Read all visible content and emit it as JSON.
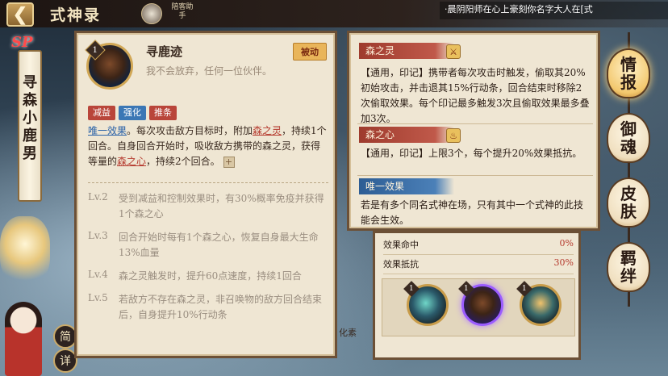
{
  "header": {
    "back_icon": "back-arrow-icon",
    "title": "式神录",
    "helper_label": "陪客助手",
    "marquee": "·晨阴阳师在心上豪刻你名字大人在[式"
  },
  "shikigami": {
    "rarity": "SP",
    "name": "寻森小鹿男"
  },
  "left_buttons": {
    "simple": "简",
    "detail": "详"
  },
  "skill": {
    "level": "1",
    "name": "寻鹿迹",
    "quote": "我不会放弃，任何一位伙伴。",
    "type": "被动",
    "tags": [
      "减益",
      "强化",
      "推条"
    ],
    "desc_parts": {
      "p1": "唯一效果",
      "p2": "。每次攻击敌方目标时，附加",
      "p3": "森之灵",
      "p4": "，持续1个回合。自身回合开始时，吸收敌方携带的森之灵，获得等量的",
      "p5": "森之心",
      "p6": "，持续2个回合。"
    },
    "levels": [
      {
        "label": "Lv.2",
        "text": "受到减益和控制效果时，有30%概率免疫并获得1个森之心"
      },
      {
        "label": "Lv.3",
        "text": "回合开始时每有1个森之心，恢复自身最大生命13%血量"
      },
      {
        "label": "Lv.4",
        "text": "森之灵触发时，提升60点速度，持续1回合"
      },
      {
        "label": "Lv.5",
        "text": "若敌方不存在森之灵，非召唤物的敌方回合结束后，自身提升10%行动条"
      }
    ]
  },
  "tooltip": {
    "sections": [
      {
        "title": "森之灵",
        "icon": "sword-icon",
        "text": "【通用，印记】携带者每次攻击时触发，偷取其20%初始攻击，并击退其15%行动条，回合结束时移除2次偷取效果。每个印记最多触发3次且偷取效果最多叠加3次。"
      },
      {
        "title": "森之心",
        "icon": "flame-icon",
        "text": "【通用，印记】上限3个，每个提升20%效果抵抗。"
      },
      {
        "title": "唯一效果",
        "icon": "",
        "text": "若是有多个同名式神在场，只有其中一个式神的此技能会生效。"
      }
    ]
  },
  "stats": [
    {
      "label": "效果命中",
      "value": "0%"
    },
    {
      "label": "效果抵抗",
      "value": "30%"
    }
  ],
  "skill_icons": [
    {
      "level": "1",
      "selected": false
    },
    {
      "level": "1",
      "selected": true
    },
    {
      "level": "1",
      "selected": false
    }
  ],
  "right_menu": [
    {
      "label": "情报",
      "active": true
    },
    {
      "label": "御魂",
      "active": false
    },
    {
      "label": "皮肤",
      "active": false
    },
    {
      "label": "羁绊",
      "active": false
    }
  ],
  "bottom_peek_label": "化素"
}
